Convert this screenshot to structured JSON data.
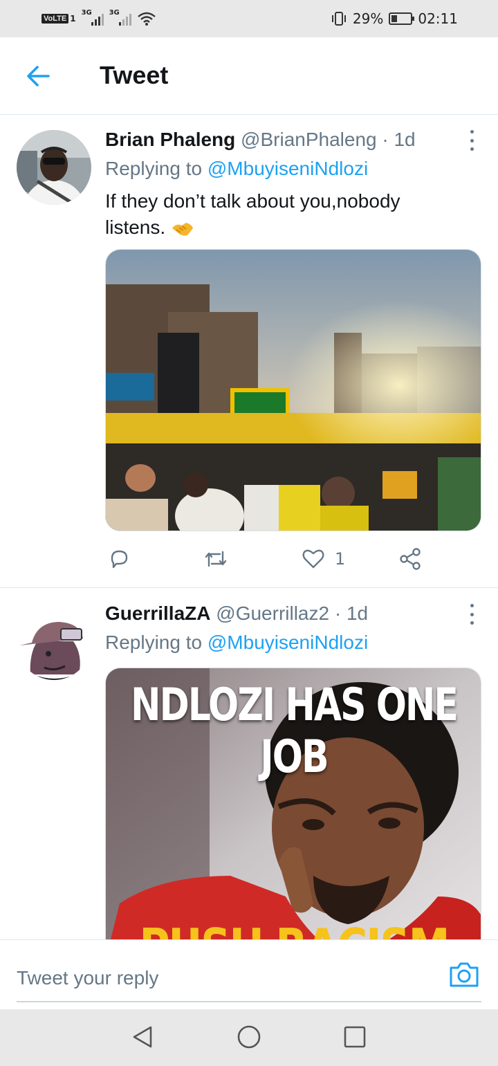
{
  "status_bar": {
    "volte": "VoLTE",
    "sim1": "1",
    "net1": "3G",
    "net2": "3G",
    "battery_percent": "29%",
    "time": "02:11"
  },
  "header": {
    "title": "Tweet",
    "back_icon": "arrow-left-icon"
  },
  "tweets": [
    {
      "author_name": "Brian Phaleng",
      "handle": "@BrianPhaleng",
      "separator": "·",
      "time": "1d",
      "replying_prefix": "Replying to ",
      "replying_to": "@MbuyiseniNdlozi",
      "text_line1": "If they don’t talk about you,nobody",
      "text_line2": "listens.",
      "emoji": "handshake-emoji",
      "media_description_icon": "photo-rally-stage",
      "like_count": "1"
    },
    {
      "author_name": "GuerrillaZA",
      "handle": "@Guerrillaz2",
      "separator": "·",
      "time": "1d",
      "replying_prefix": "Replying to ",
      "replying_to": "@MbuyiseniNdlozi",
      "meme_top_text": "NDLOZI HAS ONE JOB",
      "meme_bottom_text": "PUSH RACISM"
    }
  ],
  "reply_bar": {
    "placeholder": "Tweet your reply",
    "camera_icon": "camera-icon"
  },
  "colors": {
    "accent": "#1da1f2",
    "muted": "#657786",
    "text": "#14171a",
    "divider": "#e1e8ed"
  }
}
